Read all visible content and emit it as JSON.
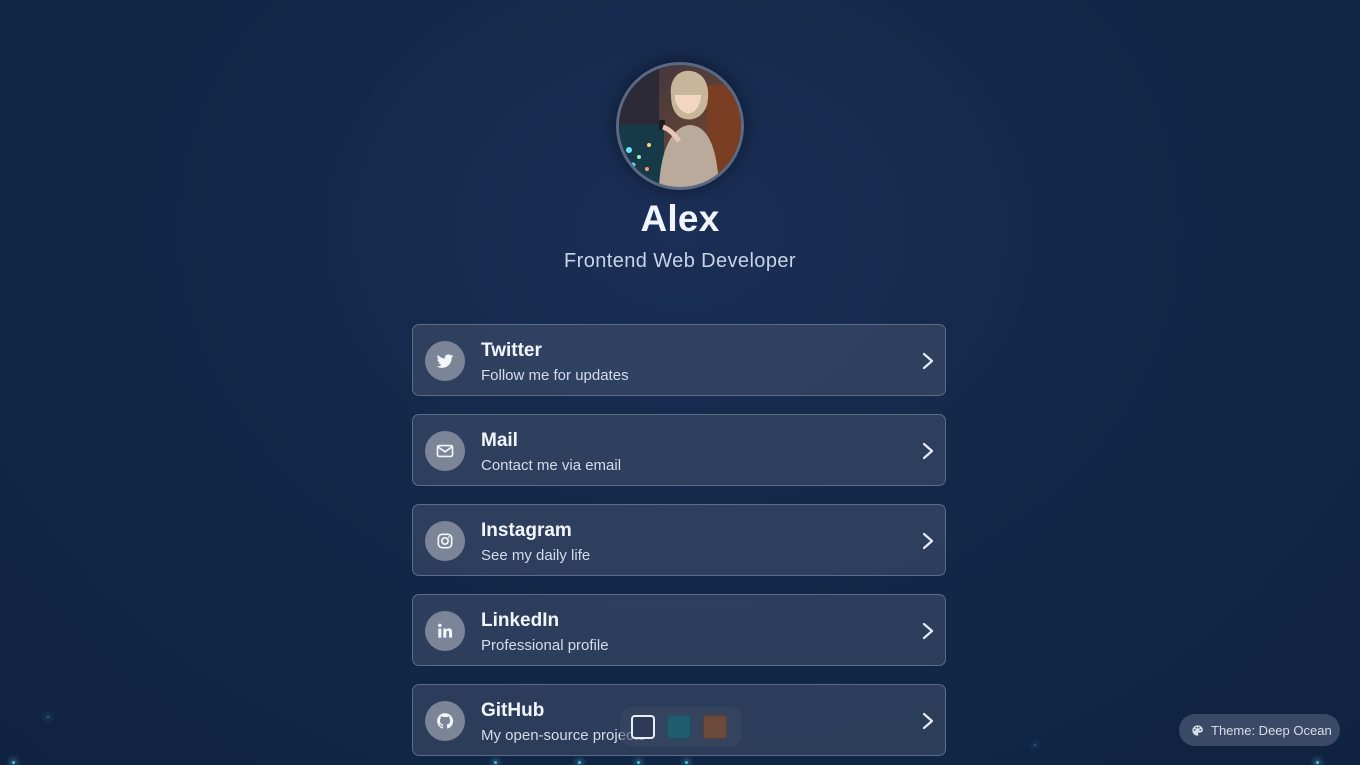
{
  "profile": {
    "name": "Alex",
    "tagline": "Frontend Web Developer"
  },
  "links": [
    {
      "title": "Twitter",
      "subtitle": "Follow me for updates",
      "icon": "twitter-icon"
    },
    {
      "title": "Mail",
      "subtitle": "Contact me via email",
      "icon": "mail-icon"
    },
    {
      "title": "Instagram",
      "subtitle": "See my daily life",
      "icon": "instagram-icon"
    },
    {
      "title": "LinkedIn",
      "subtitle": "Professional profile",
      "icon": "linkedin-icon"
    },
    {
      "title": "GitHub",
      "subtitle": "My open-source projects",
      "icon": "github-icon"
    }
  ],
  "theme_switcher": {
    "swatches": [
      {
        "color": "#2e3b55",
        "selected": true
      },
      {
        "color": "#1f5d6e",
        "selected": false
      },
      {
        "color": "#6b4a3c",
        "selected": false
      }
    ]
  },
  "theme_indicator": {
    "label": "Theme: Deep Ocean",
    "icon": "palette-icon"
  },
  "colors": {
    "background": "#132848",
    "card_background": "#3f4b63",
    "card_border": "#5b6b88",
    "icon_circle": "#7b8597",
    "star_glow": "#4fb8d8"
  }
}
